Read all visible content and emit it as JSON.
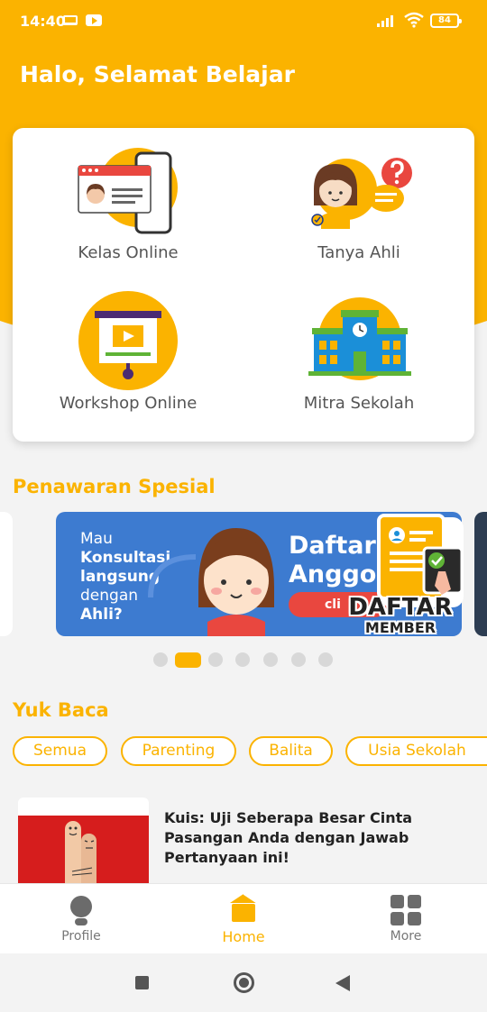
{
  "status_bar": {
    "time": "14:40",
    "battery": "84"
  },
  "header": {
    "greeting": "Halo, Selamat Belajar"
  },
  "menu": [
    {
      "label": "Kelas Online",
      "icon": "online-class-icon"
    },
    {
      "label": "Tanya Ahli",
      "icon": "ask-expert-icon"
    },
    {
      "label": "Workshop Online",
      "icon": "workshop-presentation-icon"
    },
    {
      "label": "Mitra Sekolah",
      "icon": "school-building-icon"
    }
  ],
  "special_offers": {
    "title": "Penawaran Spesial",
    "banner": {
      "line1": "Mau",
      "line2": "Konsultasi",
      "line3": "langsung",
      "line4": "dengan",
      "line5": "Ahli?",
      "headline1": "Daftar",
      "headline2": "Anggo",
      "cta": "cli",
      "sticker_line1": "DAFTAR",
      "sticker_line2": "MEMBER"
    },
    "carousel": {
      "total": 7,
      "active_index": 1
    }
  },
  "reading": {
    "title": "Yuk Baca",
    "filters": [
      "Semua",
      "Parenting",
      "Balita",
      "Usia Sekolah"
    ],
    "articles": [
      {
        "title": "Kuis: Uji Seberapa Besar Cinta Pasangan Anda dengan Jawab Pertanyaan ini!"
      }
    ]
  },
  "bottom_nav": {
    "items": [
      {
        "label": "Profile",
        "icon": "profile-icon"
      },
      {
        "label": "Home",
        "icon": "home-icon",
        "active": true
      },
      {
        "label": "More",
        "icon": "more-grid-icon"
      }
    ]
  },
  "colors": {
    "primary": "#fbb300",
    "banner_blue": "#3d7bd0",
    "red": "#e9473f"
  }
}
